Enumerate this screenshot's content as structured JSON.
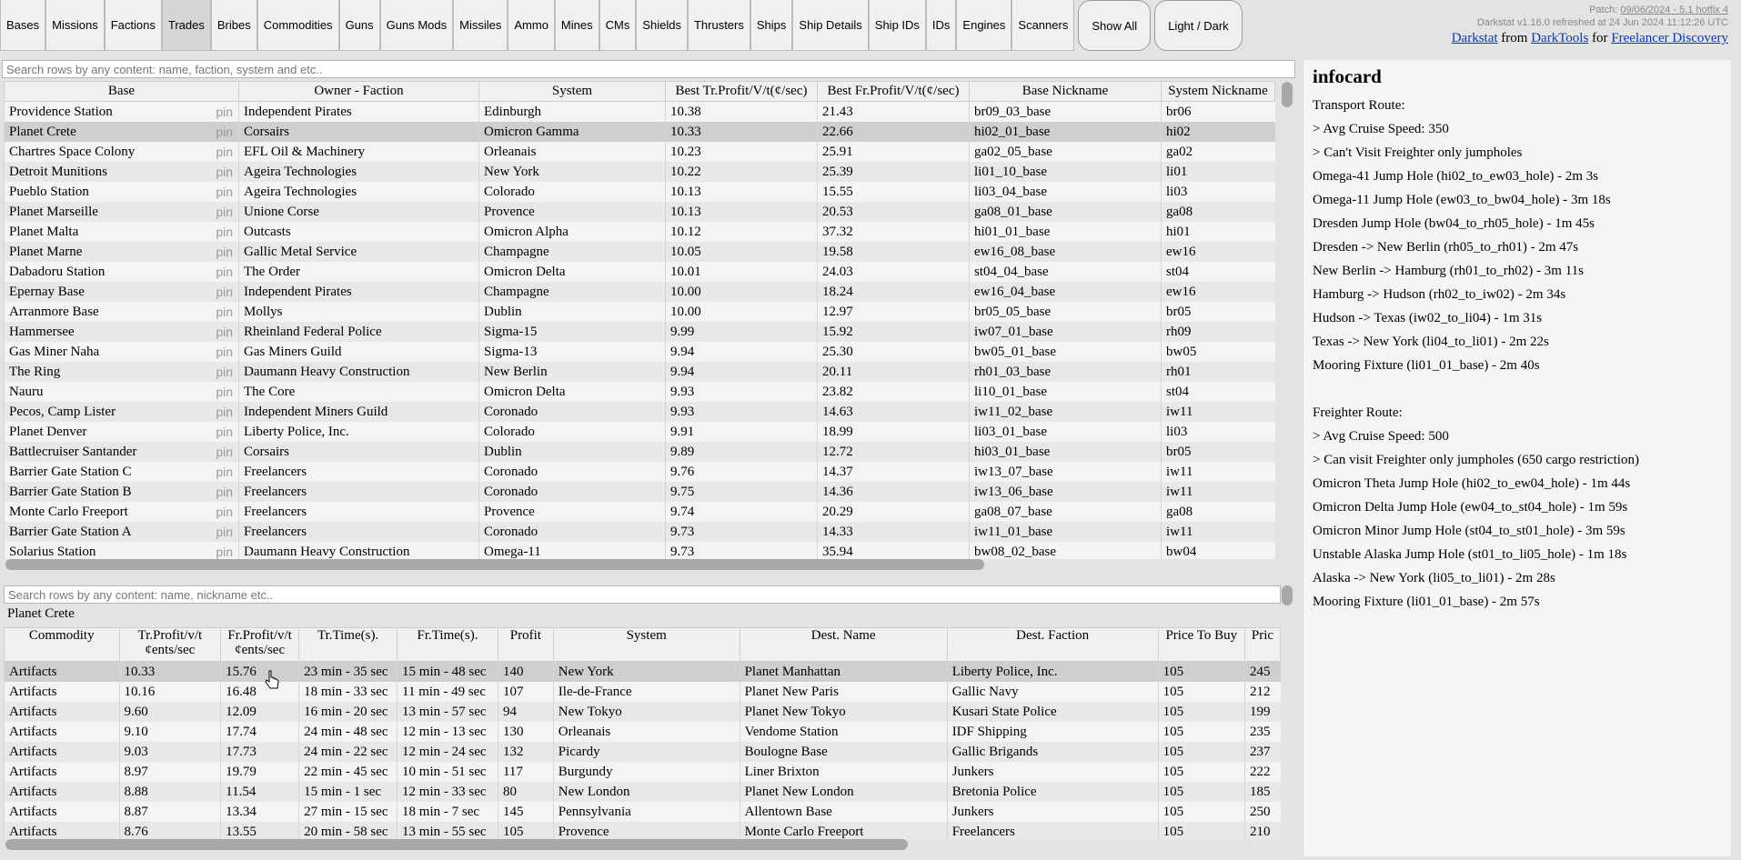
{
  "nav": {
    "tabs": [
      "Bases",
      "Missions",
      "Factions",
      "Trades",
      "Bribes",
      "Commodities",
      "Guns",
      "Guns Mods",
      "Missiles",
      "Ammo",
      "Mines",
      "CMs",
      "Shields",
      "Thrusters",
      "Ships",
      "Ship Details",
      "Ship IDs",
      "IDs",
      "Engines",
      "Scanners"
    ],
    "active": "Trades",
    "show_all": "Show All",
    "light_dark": "Light / Dark"
  },
  "patch": {
    "patch_prefix": "Patch: ",
    "patch_value": "09/06/2024 - 5.1 hotfix 4",
    "refresh": "Darkstat v1.16.0 refreshed at 24 Jun 2024 11:12:26 UTC",
    "darkstat": "Darkstat",
    "from": " from ",
    "darktools": "DarkTools",
    "for": " for ",
    "discovery": "Freelancer Discovery"
  },
  "top_table": {
    "search_placeholder": "Search rows by any content: name, faction, system and etc..",
    "headers": [
      "Base",
      "Owner - Faction",
      "System",
      "Best Tr.Profit/V/t(¢/sec)",
      "Best Fr.Profit/V/t(¢/sec)",
      "Base Nickname",
      "System Nickname"
    ],
    "pin_label": "pin",
    "selected_index": 1,
    "rows": [
      [
        "Providence Station",
        "Independent Pirates",
        "Edinburgh",
        "10.38",
        "21.43",
        "br09_03_base",
        "br06"
      ],
      [
        "Planet Crete",
        "Corsairs",
        "Omicron Gamma",
        "10.33",
        "22.66",
        "hi02_01_base",
        "hi02"
      ],
      [
        "Chartres Space Colony",
        "EFL Oil & Machinery",
        "Orleanais",
        "10.23",
        "25.91",
        "ga02_05_base",
        "ga02"
      ],
      [
        "Detroit Munitions",
        "Ageira Technologies",
        "New York",
        "10.22",
        "25.39",
        "li01_10_base",
        "li01"
      ],
      [
        "Pueblo Station",
        "Ageira Technologies",
        "Colorado",
        "10.13",
        "15.55",
        "li03_04_base",
        "li03"
      ],
      [
        "Planet Marseille",
        "Unione Corse",
        "Provence",
        "10.13",
        "20.53",
        "ga08_01_base",
        "ga08"
      ],
      [
        "Planet Malta",
        "Outcasts",
        "Omicron Alpha",
        "10.12",
        "37.32",
        "hi01_01_base",
        "hi01"
      ],
      [
        "Planet Marne",
        "Gallic Metal Service",
        "Champagne",
        "10.05",
        "19.58",
        "ew16_08_base",
        "ew16"
      ],
      [
        "Dabadoru Station",
        "The Order",
        "Omicron Delta",
        "10.01",
        "24.03",
        "st04_04_base",
        "st04"
      ],
      [
        "Epernay Base",
        "Independent Pirates",
        "Champagne",
        "10.00",
        "18.24",
        "ew16_04_base",
        "ew16"
      ],
      [
        "Arranmore Base",
        "Mollys",
        "Dublin",
        "10.00",
        "12.97",
        "br05_05_base",
        "br05"
      ],
      [
        "Hammersee",
        "Rheinland Federal Police",
        "Sigma-15",
        "9.99",
        "15.92",
        "iw07_01_base",
        "rh09"
      ],
      [
        "Gas Miner Naha",
        "Gas Miners Guild",
        "Sigma-13",
        "9.94",
        "25.30",
        "bw05_01_base",
        "bw05"
      ],
      [
        "The Ring",
        "Daumann Heavy Construction",
        "New Berlin",
        "9.94",
        "20.11",
        "rh01_03_base",
        "rh01"
      ],
      [
        "Nauru",
        "The Core",
        "Omicron Delta",
        "9.93",
        "23.82",
        "li10_01_base",
        "st04"
      ],
      [
        "Pecos, Camp Lister",
        "Independent Miners Guild",
        "Coronado",
        "9.93",
        "14.63",
        "iw11_02_base",
        "iw11"
      ],
      [
        "Planet Denver",
        "Liberty Police, Inc.",
        "Colorado",
        "9.91",
        "18.99",
        "li03_01_base",
        "li03"
      ],
      [
        "Battlecruiser Santander",
        "Corsairs",
        "Dublin",
        "9.89",
        "12.72",
        "hi03_01_base",
        "br05"
      ],
      [
        "Barrier Gate Station C",
        "Freelancers",
        "Coronado",
        "9.76",
        "14.37",
        "iw13_07_base",
        "iw11"
      ],
      [
        "Barrier Gate Station B",
        "Freelancers",
        "Coronado",
        "9.75",
        "14.36",
        "iw13_06_base",
        "iw11"
      ],
      [
        "Monte Carlo Freeport",
        "Freelancers",
        "Provence",
        "9.74",
        "20.29",
        "ga08_07_base",
        "ga08"
      ],
      [
        "Barrier Gate Station A",
        "Freelancers",
        "Coronado",
        "9.73",
        "14.33",
        "iw11_01_base",
        "iw11"
      ],
      [
        "Solarius Station",
        "Daumann Heavy Construction",
        "Omega-11",
        "9.73",
        "35.94",
        "bw08_02_base",
        "bw04"
      ]
    ]
  },
  "bottom_table": {
    "search_placeholder": "Search rows by any content: name, nickname etc..",
    "base_label": "Planet Crete",
    "headers": [
      "Commodity",
      "Tr.Profit/v/t ¢ents/sec",
      "Fr.Profit/v/t ¢ents/sec",
      "Tr.Time(s).",
      "Fr.Time(s).",
      "Profit",
      "System",
      "Dest. Name",
      "Dest. Faction",
      "Price To Buy",
      "Pric"
    ],
    "selected_index": 0,
    "rows": [
      [
        "Artifacts",
        "10.33",
        "15.76",
        "23 min - 35 sec",
        "15 min - 48 sec",
        "140",
        "New York",
        "Planet Manhattan",
        "Liberty Police, Inc.",
        "105",
        "245"
      ],
      [
        "Artifacts",
        "10.16",
        "16.48",
        "18 min - 33 sec",
        "11 min - 49 sec",
        "107",
        "Ile-de-France",
        "Planet New Paris",
        "Gallic Navy",
        "105",
        "212"
      ],
      [
        "Artifacts",
        "9.60",
        "12.09",
        "16 min - 20 sec",
        "13 min - 57 sec",
        "94",
        "New Tokyo",
        "Planet New Tokyo",
        "Kusari State Police",
        "105",
        "199"
      ],
      [
        "Artifacts",
        "9.10",
        "17.74",
        "24 min - 48 sec",
        "12 min - 13 sec",
        "130",
        "Orleanais",
        "Vendome Station",
        "IDF Shipping",
        "105",
        "235"
      ],
      [
        "Artifacts",
        "9.03",
        "17.73",
        "24 min - 22 sec",
        "12 min - 24 sec",
        "132",
        "Picardy",
        "Boulogne Base",
        "Gallic Brigands",
        "105",
        "237"
      ],
      [
        "Artifacts",
        "8.97",
        "19.79",
        "22 min - 45 sec",
        "10 min - 51 sec",
        "117",
        "Burgundy",
        "Liner Brixton",
        "Junkers",
        "105",
        "222"
      ],
      [
        "Artifacts",
        "8.88",
        "11.54",
        "15 min - 1 sec",
        "12 min - 33 sec",
        "80",
        "New London",
        "Planet New London",
        "Bretonia Police",
        "105",
        "185"
      ],
      [
        "Artifacts",
        "8.87",
        "13.34",
        "27 min - 15 sec",
        "18 min - 7 sec",
        "145",
        "Pennsylvania",
        "Allentown Base",
        "Junkers",
        "105",
        "250"
      ],
      [
        "Artifacts",
        "8.76",
        "13.55",
        "20 min - 58 sec",
        "13 min - 55 sec",
        "105",
        "Provence",
        "Monte Carlo Freeport",
        "Freelancers",
        "105",
        "210"
      ]
    ]
  },
  "infocard": {
    "title": "infocard",
    "lines": [
      "Transport Route:",
      "> Avg Cruise Speed: 350",
      "> Can't Visit Freighter only jumpholes",
      "Omega-41 Jump Hole (hi02_to_ew03_hole) - 2m 3s",
      "Omega-11 Jump Hole (ew03_to_bw04_hole) - 3m 18s",
      "Dresden Jump Hole (bw04_to_rh05_hole) - 1m 45s",
      "Dresden -> New Berlin (rh05_to_rh01) - 2m 47s",
      "New Berlin -> Hamburg (rh01_to_rh02) - 3m 11s",
      "Hamburg -> Hudson (rh02_to_iw02) - 2m 34s",
      "Hudson -> Texas (iw02_to_li04) - 1m 31s",
      "Texas -> New York (li04_to_li01) - 2m 22s",
      "Mooring Fixture (li01_01_base) - 2m 40s",
      "",
      "Freighter Route:",
      "> Avg Cruise Speed: 500",
      "> Can visit Freighter only jumpholes (650 cargo restriction)",
      "Omicron Theta Jump Hole (hi02_to_ew04_hole) - 1m 44s",
      "Omicron Delta Jump Hole (ew04_to_st04_hole) - 1m 59s",
      "Omicron Minor Jump Hole (st04_to_st01_hole) - 3m 59s",
      "Unstable Alaska Jump Hole (st01_to_li05_hole) - 1m 18s",
      "Alaska -> New York (li05_to_li01) - 2m 28s",
      "Mooring Fixture (li01_01_base) - 2m 57s"
    ]
  }
}
